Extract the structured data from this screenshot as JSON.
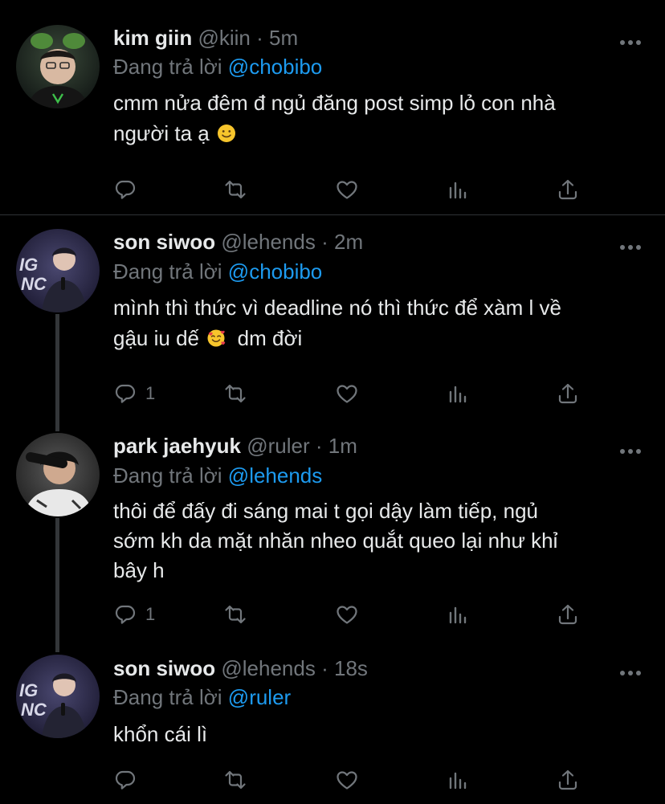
{
  "colors": {
    "background": "#000000",
    "text": "#e7e9ea",
    "muted": "#71767b",
    "mention": "#1d9bf0",
    "divider": "#2f3336",
    "thread_line": "#333639"
  },
  "tweets": [
    {
      "name": "kim giin",
      "handle": "@kiin",
      "separator": "·",
      "time": "5m",
      "replying_prefix": "Đang trả lời",
      "replying_to": "@chobibo",
      "text_line1": "cmm nửa đêm đ ngủ đăng post simp lỏ con nhà",
      "text_line2": "người ta ạ",
      "emoji": "slightly-smiling-face",
      "reply_count": "",
      "icons": [
        "reply-icon",
        "retweet-icon",
        "like-icon",
        "analytics-icon",
        "share-icon"
      ]
    },
    {
      "name": "son siwoo",
      "handle": "@lehends",
      "separator": "·",
      "time": "2m",
      "replying_prefix": "Đang trả lời",
      "replying_to": "@chobibo",
      "text_line1": "mình thì thức vì deadline nó thì thức để xàm l về",
      "text_line2a": "gậu iu dế",
      "text_line2b": "dm đời",
      "emoji": "smiling-face-with-hearts",
      "reply_count": "1"
    },
    {
      "name": "park jaehyuk",
      "handle": "@ruler",
      "separator": "·",
      "time": "1m",
      "replying_prefix": "Đang trả lời",
      "replying_to": "@lehends",
      "text_line1": "thôi để đấy đi sáng mai t gọi dậy làm tiếp, ngủ",
      "text_line2": "sớm kh da mặt nhăn nheo quắt queo lại như khỉ",
      "text_line3": "bây h",
      "reply_count": "1"
    },
    {
      "name": "son siwoo",
      "handle": "@lehends",
      "separator": "·",
      "time": "18s",
      "replying_prefix": "Đang trả lời",
      "replying_to": "@ruler",
      "text_line1": "khổn cái lì",
      "reply_count": ""
    }
  ]
}
